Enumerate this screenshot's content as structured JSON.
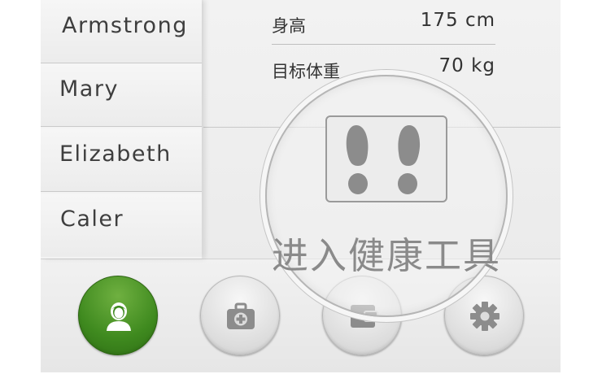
{
  "sidebar": {
    "users": [
      {
        "name": "Armstrong"
      },
      {
        "name": "Mary"
      },
      {
        "name": "Elizabeth"
      },
      {
        "name": "Caler"
      }
    ]
  },
  "profile": {
    "height_label": "身高",
    "height_value": "175 cm",
    "target_weight_label": "目标体重",
    "target_weight_value": "70 kg"
  },
  "magnifier": {
    "icon": "footprints-icon",
    "label": "进入健康工具"
  },
  "bottom_nav": [
    {
      "icon": "user-icon",
      "active": true
    },
    {
      "icon": "first-aid-kit-icon",
      "active": false
    },
    {
      "icon": "wallet-icon",
      "active": false
    },
    {
      "icon": "gear-icon",
      "active": false
    }
  ],
  "colors": {
    "accent": "#3f8a1f",
    "icon_gray": "#8c8c8c"
  }
}
